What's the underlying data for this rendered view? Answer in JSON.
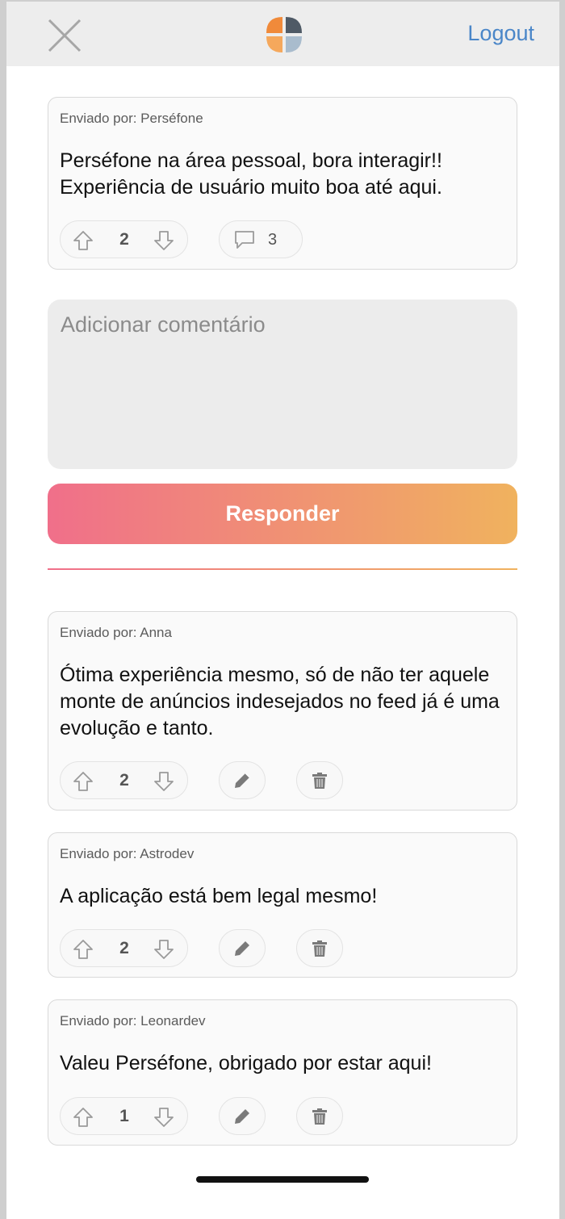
{
  "header": {
    "logout_label": "Logout"
  },
  "post": {
    "author": "Enviado por: Perséfone",
    "text": "Perséfone na área pessoal, bora interagir!! Experiência de usuário muito boa até aqui.",
    "votes": "2",
    "comments": "3"
  },
  "reply": {
    "placeholder": "Adicionar comentário",
    "button_label": "Responder"
  },
  "comments": [
    {
      "author": "Enviado por: Anna",
      "text": "Ótima experiência mesmo, só de não ter aquele monte de anúncios indesejados no feed já é uma evolução e tanto.",
      "votes": "2"
    },
    {
      "author": "Enviado por: Astrodev",
      "text": "A aplicação está bem legal mesmo!",
      "votes": "2"
    },
    {
      "author": "Enviado por: Leonardev",
      "text": "Valeu Perséfone, obrigado por estar aqui!",
      "votes": "1"
    }
  ],
  "colors": {
    "header_bg": "#ededed",
    "logout_link": "#4a86c8",
    "gradient_start": "#f06f8a",
    "gradient_end": "#f0b25e",
    "logo_orange": "#f08a3a",
    "logo_slate": "#4f5a66",
    "logo_lightblue": "#a9bccd"
  },
  "icons": {
    "close": "close-icon",
    "logo": "labeddit-logo",
    "upvote": "arrow-up-icon",
    "downvote": "arrow-down-icon",
    "comment": "speech-bubble-icon",
    "edit": "pencil-icon",
    "delete": "trash-icon"
  }
}
